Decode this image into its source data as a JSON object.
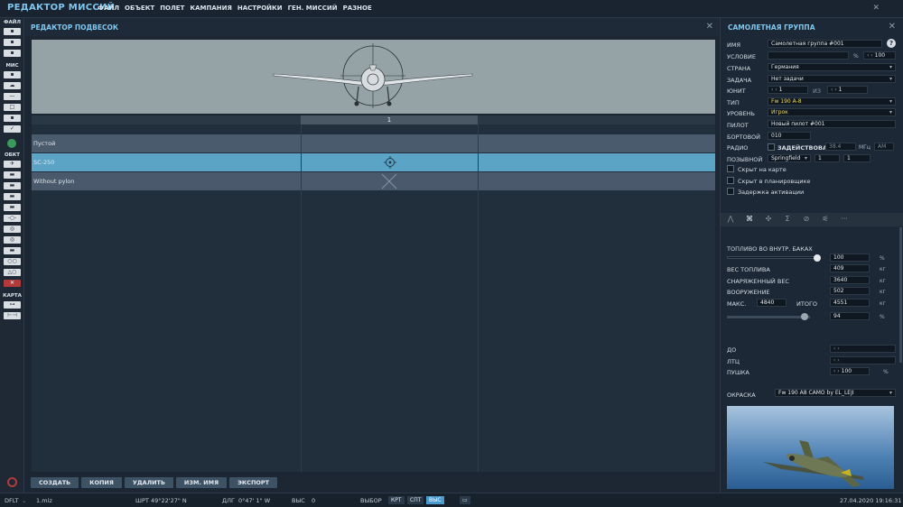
{
  "app": {
    "title": "РЕДАКТОР МИССИЙ",
    "menu": [
      "ФАЙЛ",
      "ОБЪЕКТ",
      "ПОЛЕТ",
      "КАМПАНИЯ",
      "НАСТРОЙКИ",
      "ГЕН. МИССИЙ",
      "РАЗНОЕ"
    ],
    "close_glyph": "✕"
  },
  "leftbar": {
    "file_label": "ФАЙЛ",
    "mission_label": "МИС",
    "object_label": "ОБКТ",
    "map_label": "КАРТА"
  },
  "payload_editor": {
    "title": "РЕДАКТОР ПОДВЕСОК",
    "column_header": "1",
    "rows": [
      {
        "label": "Пустой",
        "icon": "none"
      },
      {
        "label": "SC-250",
        "icon": "bomb-target-icon"
      },
      {
        "label": "Without pylon",
        "icon": "cross-icon"
      }
    ],
    "buttons": [
      "СОЗДАТЬ",
      "КОПИЯ",
      "УДАЛИТЬ",
      "ИЗМ. ИМЯ",
      "ЭКСПОРТ"
    ]
  },
  "group_panel": {
    "title": "САМОЛЕТНАЯ ГРУППА",
    "help_glyph": "?",
    "fields": {
      "name_label": "ИМЯ",
      "name_value": "Самолетная группа #001",
      "condition_label": "УСЛОВИЕ",
      "condition_value": "",
      "condition_unit": "%",
      "condition_pct": "100",
      "country_label": "СТРАНА",
      "country_value": "Германия",
      "task_label": "ЗАДАЧА",
      "task_value": "Нет задачи",
      "unit_label": "ЮНИТ",
      "unit_value": "1",
      "of_label": "ИЗ",
      "of_value": "1",
      "type_label": "ТИП",
      "type_value": "Fw 190 A-8",
      "level_label": "УРОВЕНЬ",
      "level_value": "Игрок",
      "pilot_label": "ПИЛОТ",
      "pilot_value": "Новый пилот #001",
      "tail_label": "БОРТОВОЙ",
      "tail_value": "010",
      "radio_label": "РАДИО",
      "radio_engaged": "ЗАДЕЙСТВОВАТ",
      "radio_freq": "38.4",
      "radio_unit": "МГц",
      "radio_mod": "AM",
      "callsign_label": "ПОЗЫВНОЙ",
      "callsign_value": "Springfield",
      "callsign_n1": "1",
      "callsign_n2": "1"
    },
    "checkboxes": [
      "Скрыт на карте",
      "Скрыт в планировщике",
      "Задержка активации"
    ],
    "tabs": [
      "⋀",
      "⌘",
      "✣",
      "Σ",
      "⊘",
      "⚟",
      "···"
    ],
    "fuel": {
      "title": "ТОПЛИВО ВО ВНУТР. БАКАХ",
      "fuel_pct": "100",
      "pct_unit": "%",
      "fuel_fraction": 1.0,
      "fuel_weight_label": "ВЕС ТОПЛИВА",
      "fuel_weight_value": "409",
      "empty_weight_label": "СНАРЯЖЕННЫЙ ВЕС",
      "empty_weight_value": "3640",
      "armament_label": "ВООРУЖЕНИЕ",
      "armament_value": "502",
      "max_label": "МАКС.",
      "max_value": "4840",
      "total_label": "ИТОГО",
      "total_value": "4551",
      "kg_unit": "кг",
      "load_pct": "94",
      "load_fraction": 0.94
    },
    "extra": {
      "do_label": "ДО",
      "ltc_label": "ЛТЦ",
      "gun_label": "ПУШКА",
      "gun_value": "100",
      "gun_unit": "%"
    },
    "livery": {
      "label": "ОКРАСКА",
      "value": "Fw 190 A8 CAMO by EL_LEJI"
    }
  },
  "statusbar": {
    "profile": "DFLT",
    "file": "1.miz",
    "lat_label": "ШРТ",
    "lat_value": "49°22'27\" N",
    "lon_label": "ДЛГ",
    "lon_value": "0°47' 1\" W",
    "alt_label": "ВЫС",
    "alt_value": "0",
    "select_label": "ВЫБОР",
    "modes": [
      "КРТ",
      "СПТ",
      "ВЫС"
    ],
    "datetime": "27.04.2020 19:16:31"
  }
}
